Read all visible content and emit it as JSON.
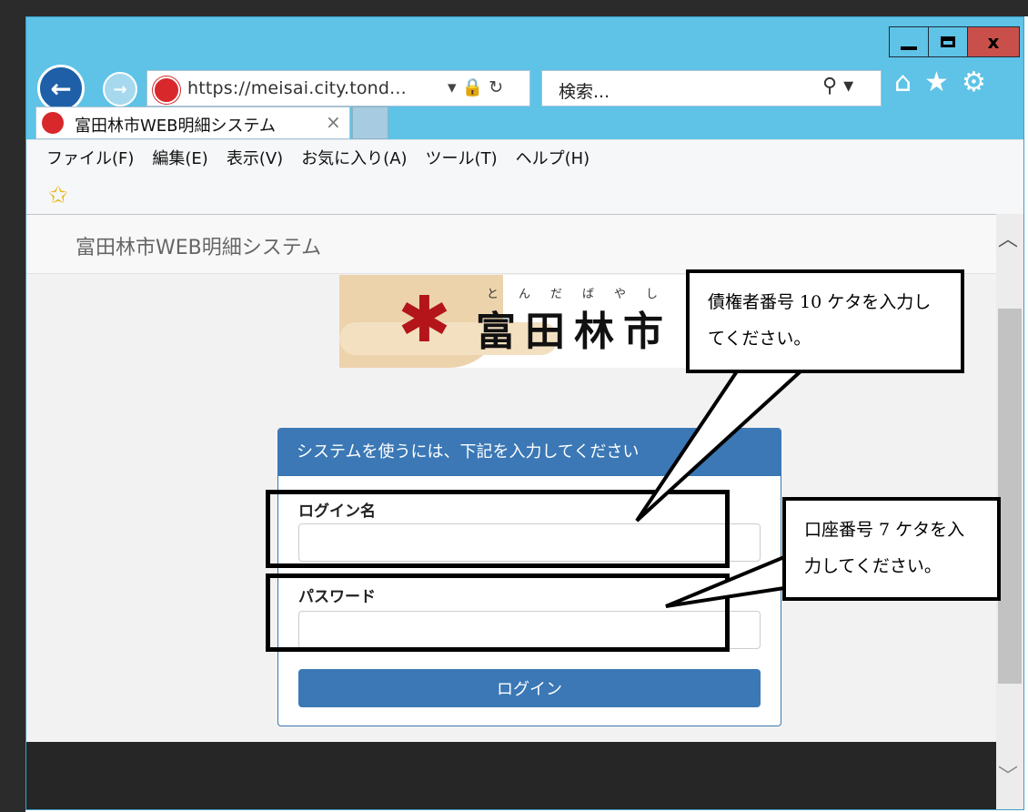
{
  "browser": {
    "address_url": "https://meisai.city.tond...",
    "address_tools": "▾ 🔒 ↻",
    "search_placeholder": "検索...",
    "search_icon": "⚲ ▾",
    "tab_title": "富田林市WEB明細システム",
    "tab_close": "×",
    "window_close": "x",
    "icons": [
      "back-arrow-icon",
      "forward-arrow-icon",
      "home-icon",
      "star-icon",
      "gear-icon"
    ]
  },
  "menu": [
    "ファイル(F)",
    "編集(E)",
    "表示(V)",
    "お気に入り(A)",
    "ツール(T)",
    "ヘルプ(H)"
  ],
  "page": {
    "brand": "富田林市WEB明細システム",
    "logo_ruby": "とんだばやし",
    "logo_name": "富田林市",
    "panel_header": "システムを使うには、下記を入力してください",
    "login_label": "ログイン名",
    "password_label": "パスワード",
    "login_button": "ログイン"
  },
  "callouts": {
    "login_note": "債権者番号 10 ケタを入力してください。",
    "password_note": "口座番号 7 ケタを入力してください。"
  },
  "colors": {
    "accent": "#3b78b5",
    "frame": "#5ec3e6",
    "close": "#c9504a"
  }
}
